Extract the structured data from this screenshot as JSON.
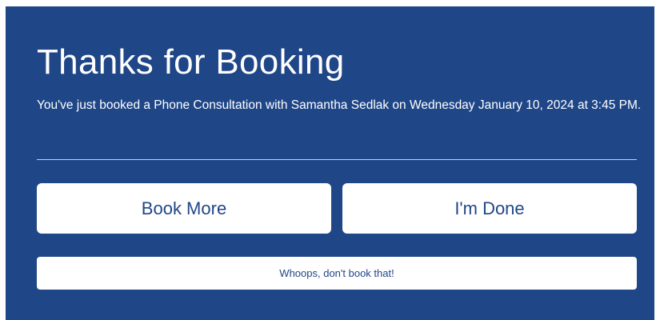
{
  "confirmation": {
    "title": "Thanks for Booking",
    "message": "You've just booked a Phone Consultation with Samantha Sedlak on Wednesday January 10, 2024 at 3:45 PM."
  },
  "actions": {
    "book_more_label": "Book More",
    "done_label": "I'm Done",
    "cancel_label": "Whoops, don't book that!"
  },
  "colors": {
    "panel_background": "#1f4687",
    "button_background": "#ffffff",
    "button_text": "#1f4687"
  }
}
